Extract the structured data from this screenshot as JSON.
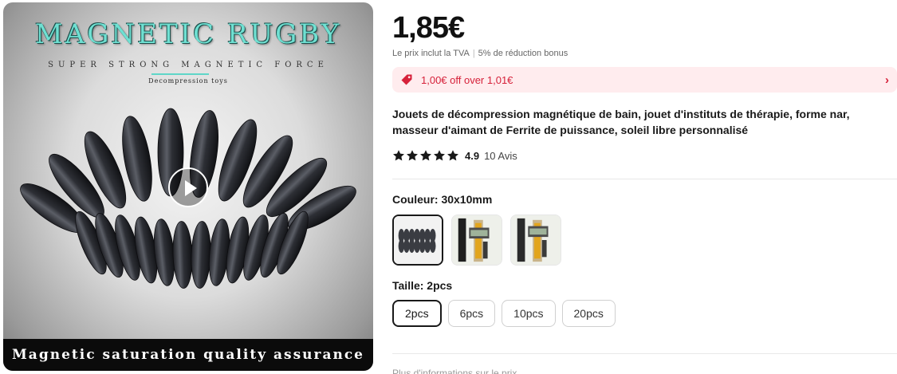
{
  "media": {
    "title": "MAGNETIC RUGBY",
    "subtitle": "SUPER STRONG MAGNETIC FORCE",
    "subtitle2": "Decompression toys",
    "bottom_text": "Magnetic saturation quality assurance"
  },
  "price": "1,85€",
  "tax_note": "Le prix inclut la TVA",
  "bonus_note": "5% de réduction bonus",
  "coupon": {
    "text": "1,00€ off over 1,01€",
    "color": "#d6213a"
  },
  "product_title": "Jouets de décompression magnétique de bain, jouet d'instituts de thérapie, forme nar, masseur d'aimant de Ferrite de puissance, soleil libre personnalisé",
  "rating": {
    "stars": 5,
    "value": "4.9",
    "reviews": "10 Avis"
  },
  "color_option": {
    "label": "Couleur: 30x10mm",
    "swatches": [
      {
        "name": "magnets-row",
        "selected": true
      },
      {
        "name": "caliper-1",
        "selected": false
      },
      {
        "name": "caliper-2",
        "selected": false
      }
    ]
  },
  "size_option": {
    "label": "Taille: 2pcs",
    "options": [
      "2pcs",
      "6pcs",
      "10pcs",
      "20pcs"
    ],
    "selected": "2pcs"
  },
  "more_info": "Plus d'informations sur le prix"
}
